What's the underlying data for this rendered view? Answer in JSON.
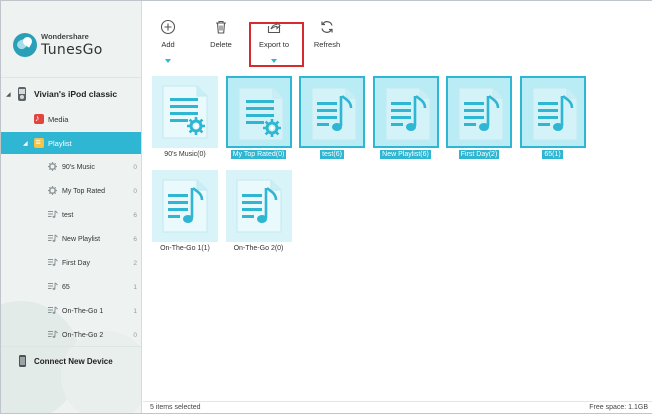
{
  "app": {
    "brand": "Wondershare",
    "product": "TunesGo"
  },
  "sidebar": {
    "device": "Vivian's iPod classic",
    "media_label": "Media",
    "playlist_label": "Playlist",
    "playlists": [
      {
        "label": "90's Music",
        "count": "0",
        "icon": "gear-icon"
      },
      {
        "label": "My Top Rated",
        "count": "0",
        "icon": "gear-icon"
      },
      {
        "label": "test",
        "count": "6",
        "icon": "playlist-note-icon"
      },
      {
        "label": "New Playlist",
        "count": "6",
        "icon": "playlist-note-icon"
      },
      {
        "label": "First Day",
        "count": "2",
        "icon": "playlist-note-icon"
      },
      {
        "label": "65",
        "count": "1",
        "icon": "playlist-note-icon"
      },
      {
        "label": "On-The-Go 1",
        "count": "1",
        "icon": "playlist-note-icon"
      },
      {
        "label": "On-The-Go 2",
        "count": "0",
        "icon": "playlist-note-icon"
      }
    ],
    "connect_label": "Connect New Device"
  },
  "toolbar": {
    "add_label": "Add",
    "delete_label": "Delete",
    "export_label": "Export to",
    "refresh_label": "Refresh"
  },
  "tiles": [
    {
      "label": "90's Music(0)",
      "type": "smart",
      "selected": false
    },
    {
      "label": "My Top Rated(0)",
      "type": "smart",
      "selected": true
    },
    {
      "label": "test(6)",
      "type": "music",
      "selected": true
    },
    {
      "label": "New Playlist(6)",
      "type": "music",
      "selected": true
    },
    {
      "label": "First Day(2)",
      "type": "music",
      "selected": true
    },
    {
      "label": "65(1)",
      "type": "music",
      "selected": true
    },
    {
      "label": "On-The-Go 1(1)",
      "type": "music",
      "selected": false
    },
    {
      "label": "On-The-Go 2(0)",
      "type": "music",
      "selected": false
    }
  ],
  "status": {
    "left": "5 items selected",
    "right": "Free space: 1.1GB"
  },
  "colors": {
    "accent": "#2fb6d2",
    "selection_fill": "#b9ecf5",
    "export_highlight": "#d52b2f",
    "sidebar_bg": "#eef3f1"
  }
}
